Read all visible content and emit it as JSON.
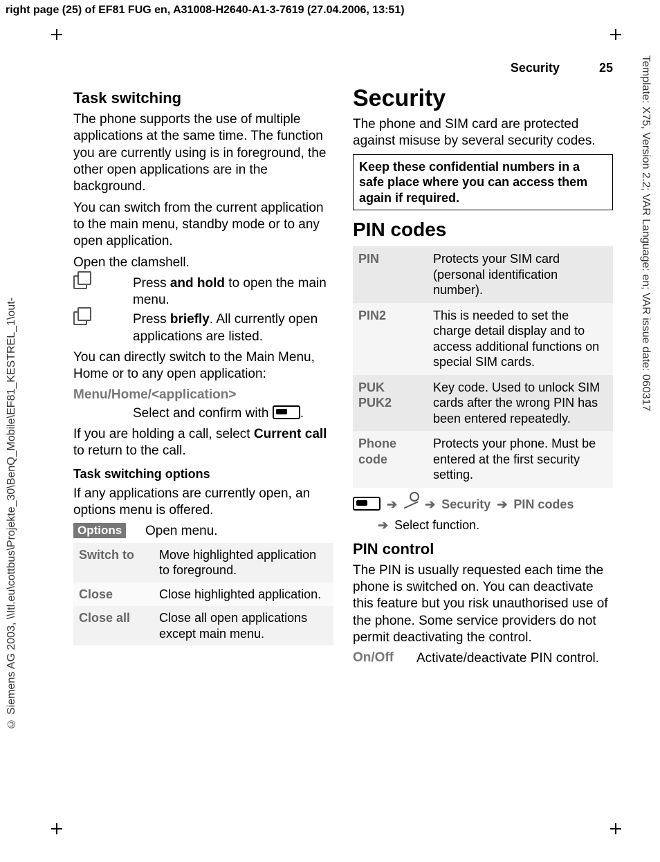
{
  "meta": {
    "topline": "right page (25) of EF81 FUG en, A31008-H2640-A1-3-7619 (27.04.2006, 13:51)",
    "right_margin": "Template: X75, Version 2.2; VAR Language: en; VAR issue date: 060317",
    "left_margin": "© Siemens AG 2003, \\\\Itl.eu\\cottbus\\Projekte_30\\BenQ_Mobile\\EF81_KESTREL_1\\out-"
  },
  "header": {
    "title": "Security",
    "page_no": "25"
  },
  "left": {
    "h_task": "Task switching",
    "p1": "The phone supports the use of multiple applications at the same time. The function you are currently using is in foreground, the other open applications are in the background.",
    "p2": "You can switch from the current application to the main menu, standby mode or to any open application.",
    "p3": "Open the clamshell.",
    "hold": {
      "pre": "Press ",
      "bold": "and hold",
      "post": " to open the main menu."
    },
    "brief": {
      "pre": "Press ",
      "bold": "briefly",
      "post": ". All currently open applications are listed."
    },
    "p4": "You can directly switch to the Main Menu, Home or to any open application:",
    "menu_label": "Menu/Home/<application>",
    "sel_confirm": "Select and confirm with ",
    "sel_confirm_dot": ".",
    "p5a": "If you are holding a call, select ",
    "p5b": "Current call",
    "p5c": " to return to the call.",
    "h_opts": "Task switching options",
    "p6": "If any applications are currently open, an options menu is offered.",
    "options_badge": "Options",
    "options_open": "Open menu.",
    "opts": [
      {
        "k": "Switch to",
        "v": "Move highlighted application to foreground."
      },
      {
        "k": "Close",
        "v": "Close highlighted application."
      },
      {
        "k": "Close all",
        "v": "Close all open applications except main menu."
      }
    ]
  },
  "right": {
    "h_security": "Security",
    "p1": "The phone and SIM card are protected against misuse by several security codes.",
    "keepbox": "Keep these confidential numbers in a safe place where you can access them again if required.",
    "h_pin": "PIN codes",
    "codes": [
      {
        "k": "PIN",
        "v": "Protects your SIM card (personal identification number)."
      },
      {
        "k": "PIN2",
        "v": "This is needed to set the charge detail display and to access additional functions on special SIM cards."
      },
      {
        "k": "PUK\nPUK2",
        "v": "Key code. Used to unlock SIM cards after the wrong PIN has been entered repeatedly."
      },
      {
        "k": "Phone code",
        "v": "Protects your phone. Must be entered at the first security setting."
      }
    ],
    "nav": {
      "seg1": "Security",
      "seg2": "PIN codes",
      "sub": "Select function."
    },
    "h_pinctrl": "PIN control",
    "p2": "The PIN is usually requested each time the phone is switched on. You can deactivate this feature but you risk unauthorised use of the phone. Some service providers do not permit deactivating the control.",
    "onoff_k": "On/Off",
    "onoff_v": "Activate/deactivate PIN control."
  }
}
